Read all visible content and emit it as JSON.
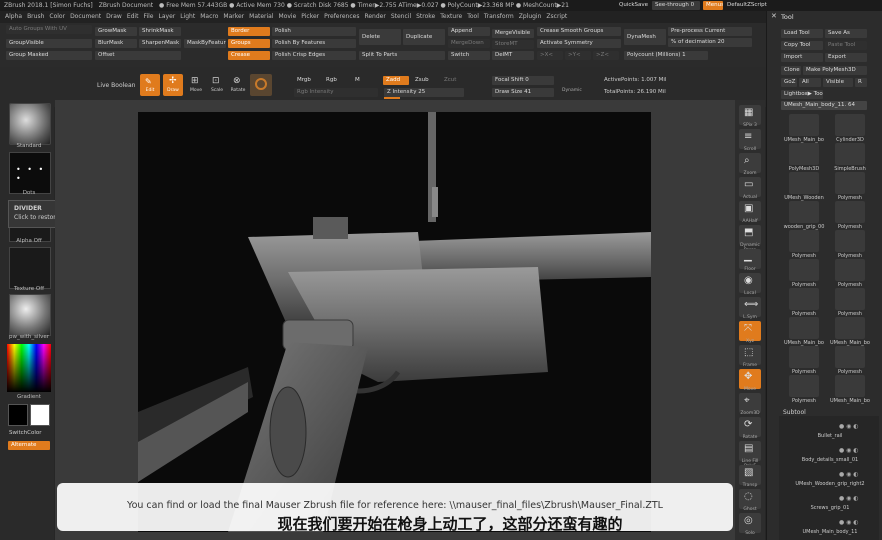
{
  "titlebar": {
    "app": "ZBrush 2018.1 [Simon Fuchs]",
    "doc": "ZBrush Document",
    "stats": "● Free Mem 57.443GB ● Active Mem 730 ● Scratch Disk 7685 ● Timer▶2.755 ATime▶0.027 ● PolyCount▶23.368 MP ● MeshCount▶21",
    "quicksave": "QuickSave",
    "seethrough": "See-through 0",
    "menus": "Menus",
    "script": "DefaultZScript"
  },
  "menu": [
    "Alpha",
    "Brush",
    "Color",
    "Document",
    "Draw",
    "Edit",
    "File",
    "Layer",
    "Light",
    "Macro",
    "Marker",
    "Material",
    "Movie",
    "Picker",
    "Preferences",
    "Render",
    "Stencil",
    "Stroke",
    "Texture",
    "Tool",
    "Transform",
    "Zplugin",
    "Zscript"
  ],
  "palette": {
    "auto_groups": "Auto Groups With UV",
    "group_visible": "GroupVisible",
    "group_masked": "Group Masked",
    "grow_mask": "GrowMask",
    "shrink_mask": "ShrinkMask",
    "blur_mask": "BlurMask",
    "sharpen_mask": "SharpenMask",
    "offset": "Offset",
    "mask_by_feature": "MaskByFeature",
    "border": "Border",
    "groups": "Groups",
    "crease": "Crease",
    "polish": "Polish",
    "polish_by_features": "Polish By Features",
    "polish_crisp": "Polish Crisp Edges",
    "delete": "Delete",
    "duplicate": "Duplicate",
    "split_to_parts": "Split To Parts",
    "append": "Append",
    "merge_down": "MergeDown",
    "switch": "Switch",
    "merge_visible": "MergeVisible",
    "store_mt": "StoreMT",
    "del_mt": "DelMT",
    "crease_smooth": "Crease Smooth Groups",
    "activate_symmetry": "Activate Symmetry",
    "sym_x": ">X<",
    "sym_y": ">Y<",
    "sym_z": ">Z<",
    "dynamesh": "DynaMesh",
    "preprocess": "Pre-process Current",
    "decimation": "% of decimation 20",
    "polycount": "Polycount (Millions) 1"
  },
  "toolbar2": {
    "live_boolean": "Live Boolean",
    "edit": "Edit",
    "draw": "Draw",
    "move": "Move",
    "scale": "Scale",
    "rotate": "Rotate",
    "mrgb": "Mrgb",
    "rgb": "Rgb",
    "m": "M",
    "rgb_intensity": "Rgb Intensity",
    "zadd": "Zadd",
    "zsub": "Zsub",
    "zcut": "Zcut",
    "z_intensity": "Z Intensity 25",
    "focal_shift": "Focal Shift 0",
    "draw_size": "Draw Size 41",
    "dynamic": "Dynamic",
    "active_points": "ActivePoints: 1.007 Mil",
    "total_points": "TotalPoints: 26.190 Mil"
  },
  "left_shelf": {
    "standard": "Standard",
    "dots": "Dots",
    "alpha_off": "Alpha Off",
    "texture_off": "Texture Off",
    "material": "pw_with_silver",
    "gradient": "Gradient",
    "switch_color": "SwitchColor",
    "alternate": "Alternate"
  },
  "tooltip": {
    "title": "DIVIDER",
    "body": "Click to restore previous position."
  },
  "right_shelf": [
    "SPix 3",
    "Scroll",
    "Zoom",
    "Actual",
    "AAHalf",
    "Dynamic Persp",
    "Floor",
    "Local",
    "L.Sym",
    "Xyz",
    "Frame",
    "Move",
    "Zoom3D",
    "Rotate",
    "Line Fill PolyF",
    "Transp",
    "Ghost",
    "Solo"
  ],
  "tool_panel": {
    "title": "Tool",
    "load_tool": "Load Tool",
    "save_as": "Save As",
    "copy_tool": "Copy Tool",
    "paste_tool": "Paste Tool",
    "import": "Import",
    "export": "Export",
    "clone": "Clone",
    "make_polymesh": "Make PolyMesh3D",
    "goz": "GoZ",
    "all": "All",
    "visible": "Visible",
    "r": "R",
    "lightbox": "Lightbox▶ Tools",
    "current": "UMesh_Main_body_11. 64",
    "count_26": "26",
    "count_2r": "2R",
    "tools": [
      "UMesh_Main_bo",
      "Cylinder3D",
      "PolyMesh3D",
      "SimpleBrush",
      "UMesh_Wooden",
      "Polymesh",
      "wooden_grip_00",
      "Polymesh",
      "Polymesh",
      "Polymesh",
      "Polymesh",
      "Polymesh",
      "Polymesh",
      "Polymesh",
      "UMesh_Main_bo",
      "UMesh_Main_bo",
      "Polymesh",
      "Polymesh",
      "Polymesh",
      "UMesh_Main_bo"
    ],
    "subtool_title": "Subtool",
    "subtools": [
      "Bullet_rail",
      "Body_details_small_01",
      "UMesh_Wooden_grip_right2",
      "Screws_grip_01",
      "UMesh_Main_body_11"
    ]
  },
  "subtitles": {
    "english": "You can find or load the final Mauser Zbrush file for reference here: \\\\mauser_final_files\\Zbrush\\Mauser_Final.ZTL",
    "chinese": "现在我们要开始在枪身上动工了，这部分还蛮有趣的"
  },
  "colors": {
    "accent": "#e07b1d",
    "panel": "#2b2b2b"
  }
}
